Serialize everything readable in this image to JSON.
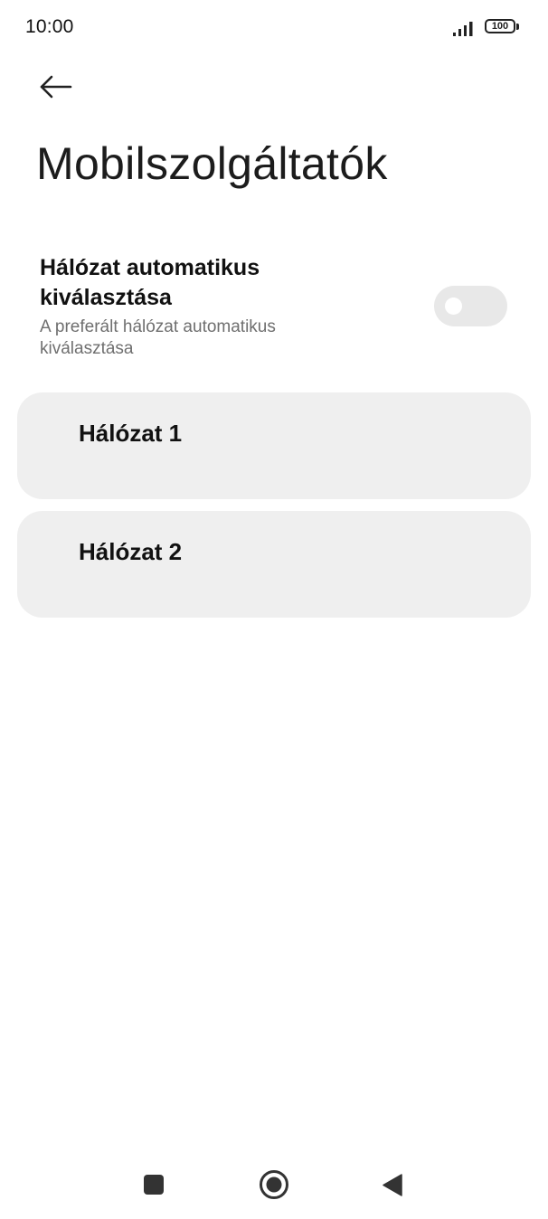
{
  "status_bar": {
    "time": "10:00",
    "battery": "100",
    "signal_icon": "signal-bars-icon",
    "battery_icon": "battery-icon"
  },
  "header": {
    "back_icon": "arrow-left-icon",
    "title": "Mobilszolgáltatók"
  },
  "auto_select": {
    "title": "Hálózat automatikus kiválasztása",
    "subtitle": "A preferált hálózat automatikus kiválasztása",
    "toggle_on": false
  },
  "networks": [
    {
      "label": "Hálózat 1"
    },
    {
      "label": "Hálózat 2"
    }
  ],
  "nav_bar": {
    "recents_icon": "square-recents-icon",
    "home_icon": "circle-home-icon",
    "back_icon": "triangle-back-icon"
  },
  "colors": {
    "card_background": "#efefef",
    "toggle_track": "#e8e8e8",
    "subtitle_text": "#6f6f6f"
  }
}
